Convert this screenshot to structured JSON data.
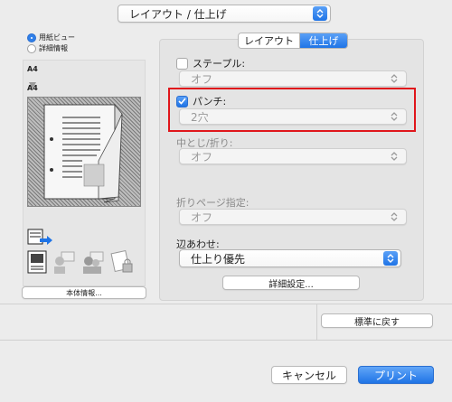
{
  "top_popup": {
    "label": "レイアウト / 仕上げ"
  },
  "view_options": [
    {
      "label": "用紙ビュー",
      "selected": true
    },
    {
      "label": "詳細情報",
      "selected": false
    }
  ],
  "preview": {
    "paper_top": "A4",
    "paper_bottom": "A4"
  },
  "machine_info_button": "本体情報...",
  "tabs": [
    {
      "label": "レイアウト",
      "active": false
    },
    {
      "label": "仕上げ",
      "active": true
    }
  ],
  "staple": {
    "label": "ステープル:",
    "checked": false,
    "value": "オフ"
  },
  "punch": {
    "label": "パンチ:",
    "checked": true,
    "value": "2穴"
  },
  "center_fold": {
    "label": "中とじ/折り:",
    "value": "オフ"
  },
  "fold_page": {
    "label": "折りページ指定:",
    "value": "オフ"
  },
  "edge_align": {
    "label": "辺あわせ:",
    "value": "仕上り優先"
  },
  "detail_settings_button": "詳細設定...",
  "reset_button": "標準に戻す",
  "cancel_button": "キャンセル",
  "print_button": "プリント",
  "colors": {
    "accent": "#1f74e6",
    "highlight": "#e0161b"
  }
}
